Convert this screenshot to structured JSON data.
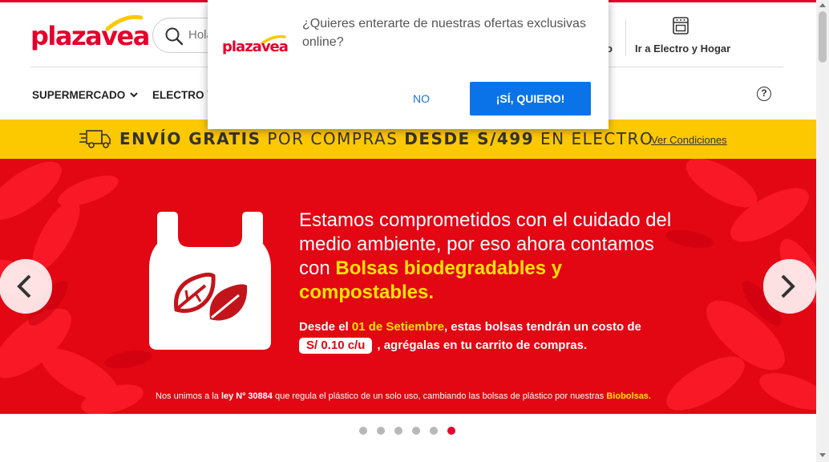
{
  "header": {
    "logo_text": "plazavea",
    "search": {
      "placeholder": "Hola"
    },
    "truncated_link": "o",
    "electro_link": "Ir a Electro y Hogar"
  },
  "nav": {
    "items": [
      {
        "label": "SUPERMERCADO"
      },
      {
        "label": "ELECTRO Y"
      }
    ],
    "help_label": "?"
  },
  "promo": {
    "bold1": "ENVÍO GRATIS",
    "normal1": "POR COMPRAS",
    "bold2": "DESDE S/499",
    "normal2": "EN ELECTRO",
    "link": "Ver Condiciones"
  },
  "banner": {
    "line1": "Estamos comprometidos con el cuidado del medio ambiente, por eso ahora contamos con",
    "line1_highlight": "Bolsas biodegradables y compostables.",
    "sub_prefix": "Desde el",
    "sub_date": "01 de Setiembre",
    "sub_middle": ", estas bolsas tendrán un costo de",
    "price": "S/ 0.10 c/u",
    "sub_suffix": ", agrégalas en tu carrito de compras.",
    "foot_prefix": "Nos unimos a la",
    "foot_law": "ley Nº 30884",
    "foot_middle": "que regula el plástico de un solo uso, cambiando las bolsas de plástico por nuestras",
    "foot_highlight": "Biobolsas."
  },
  "carousel": {
    "slide_count": 6,
    "active_index": 5
  },
  "popup": {
    "logo_text": "plazavea",
    "message": "¿Quieres enterarte de nuestras ofertas exclusivas online?",
    "no_label": "NO",
    "yes_label": "¡SÍ, QUIERO!"
  },
  "colors": {
    "brand_red": "#e4002b",
    "promo_yellow": "#fcc800",
    "banner_red": "#e30613",
    "highlight_yellow": "#ffe500",
    "button_blue": "#0b73e8"
  }
}
